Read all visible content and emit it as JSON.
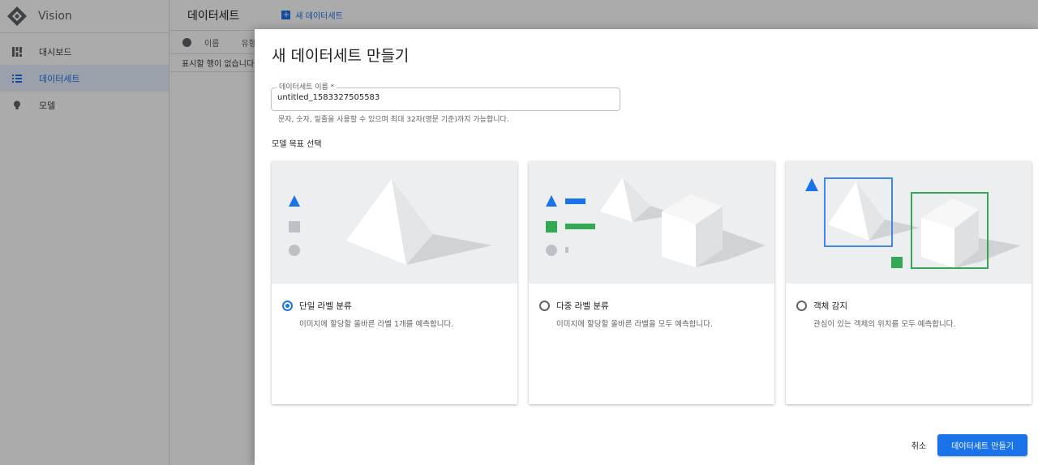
{
  "app": {
    "brand_name": "Vision",
    "nav": [
      {
        "label": "대시보드",
        "icon": "dashboard-icon"
      },
      {
        "label": "데이터세트",
        "icon": "list-icon",
        "active": true
      },
      {
        "label": "모델",
        "icon": "lightbulb-icon"
      }
    ]
  },
  "main": {
    "title": "데이터세트",
    "new_dataset_label": "새 데이터세트",
    "table": {
      "col_name": "이름",
      "col_type": "유형",
      "empty_text": "표시할 행이 없습니다"
    }
  },
  "dialog": {
    "title": "새 데이터세트 만들기",
    "name_field": {
      "label": "데이터세트 이름 *",
      "value": "untitled_1583327505583",
      "hint": "문자, 숫자, 밑줄을 사용할 수 있으며 최대 32자(영문 기준)까지 가능합니다."
    },
    "section_label": "모델 목표 선택",
    "options": [
      {
        "title": "단일 라벨 분류",
        "desc": "이미지에 할당할 올바른 라벨 1개를 예측합니다.",
        "selected": true
      },
      {
        "title": "다중 라벨 분류",
        "desc": "이미지에 할당할 올바른 라벨을 모두 예측합니다.",
        "selected": false
      },
      {
        "title": "객체 감지",
        "desc": "관심이 있는 객체의 위치를 모두 예측합니다.",
        "selected": false
      }
    ],
    "cancel_label": "취소",
    "create_label": "데이터세트 만들기"
  },
  "colors": {
    "accent": "#1a73e8",
    "green": "#34a853",
    "gray_shape": "#bdc1c6"
  }
}
